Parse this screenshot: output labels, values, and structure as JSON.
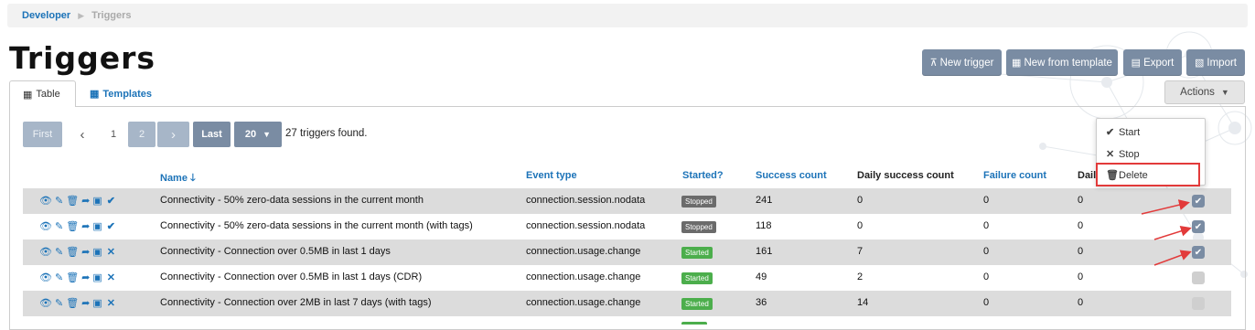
{
  "breadcrumb": {
    "parent": "Developer",
    "current": "Triggers"
  },
  "page_title": "Triggers",
  "toolbar": {
    "new_trigger": "New trigger",
    "new_from_template": "New from template",
    "export": "Export",
    "import": "Import"
  },
  "tabs": {
    "table": "Table",
    "templates": "Templates"
  },
  "actions": {
    "label": "Actions",
    "menu": {
      "start": "Start",
      "stop": "Stop",
      "delete": "Delete"
    }
  },
  "pager": {
    "first": "First",
    "prev": "‹",
    "page1": "1",
    "page2": "2",
    "next": "›",
    "last": "Last",
    "page_size": "20",
    "found": "27 triggers found."
  },
  "columns": {
    "name": "Name",
    "event_type": "Event type",
    "started": "Started?",
    "success_count": "Success count",
    "daily_success_count": "Daily success count",
    "failure_count": "Failure count",
    "daily_failure_count": "Dail"
  },
  "rows": [
    {
      "name": "Connectivity - 50% zero-data sessions in the current month",
      "event": "connection.session.nodata",
      "status": "Stopped",
      "success": "241",
      "daily_success": "0",
      "failure": "0",
      "daily_failure": "0",
      "checked": true,
      "action": "✔"
    },
    {
      "name": "Connectivity - 50% zero-data sessions in the current month (with tags)",
      "event": "connection.session.nodata",
      "status": "Stopped",
      "success": "118",
      "daily_success": "0",
      "failure": "0",
      "daily_failure": "0",
      "checked": true,
      "action": "✔"
    },
    {
      "name": "Connectivity - Connection over 0.5MB in last 1 days",
      "event": "connection.usage.change",
      "status": "Started",
      "success": "161",
      "daily_success": "7",
      "failure": "0",
      "daily_failure": "0",
      "checked": true,
      "action": "✕"
    },
    {
      "name": "Connectivity - Connection over 0.5MB in last 1 days (CDR)",
      "event": "connection.usage.change",
      "status": "Started",
      "success": "49",
      "daily_success": "2",
      "failure": "0",
      "daily_failure": "0",
      "checked": false,
      "action": "✕"
    },
    {
      "name": "Connectivity - Connection over 2MB in last 7 days (with tags)",
      "event": "connection.usage.change",
      "status": "Started",
      "success": "36",
      "daily_success": "14",
      "failure": "0",
      "daily_failure": "0",
      "checked": false,
      "action": "✕"
    }
  ],
  "colors": {
    "accent": "#1c73b8",
    "button": "#7a8ca3",
    "started": "#4cae4c",
    "stopped": "#6b6b6b",
    "highlight": "#e23a3a"
  },
  "icons": {
    "row_actions": [
      "eye-icon",
      "edit-icon",
      "trash-icon",
      "share-icon",
      "clipboard-icon"
    ]
  }
}
